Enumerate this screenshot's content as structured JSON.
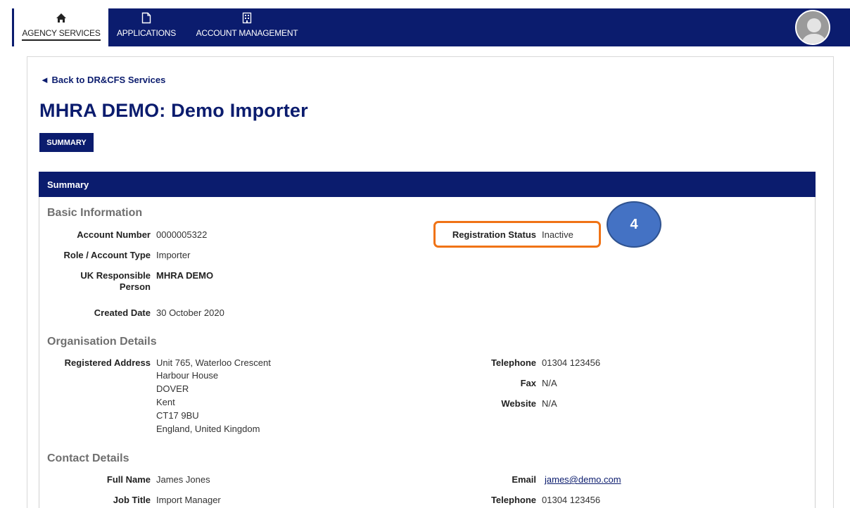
{
  "nav": {
    "items": [
      {
        "label": "AGENCY SERVICES",
        "icon": "home-icon"
      },
      {
        "label": "APPLICATIONS",
        "icon": "document-icon"
      },
      {
        "label": "ACCOUNT MANAGEMENT",
        "icon": "building-icon"
      }
    ],
    "accent": "#0b1c6e"
  },
  "back_link": "◄ Back to DR&CFS Services",
  "page_title": "MHRA DEMO: Demo Importer",
  "tabs": {
    "summary": "SUMMARY"
  },
  "panel_header": "Summary",
  "basic": {
    "title": "Basic Information",
    "account_number_label": "Account Number",
    "account_number": "0000005322",
    "role_label": "Role / Account Type",
    "role": "Importer",
    "ukrp_label_1": "UK Responsible",
    "ukrp_label_2": "Person",
    "ukrp": "MHRA DEMO",
    "created_label": "Created Date",
    "created": "30 October 2020",
    "reg_status_label": "Registration Status",
    "reg_status": "Inactive"
  },
  "org": {
    "title": "Organisation Details",
    "address_label": "Registered Address",
    "address": [
      "Unit 765, Waterloo Crescent",
      "Harbour House",
      "DOVER",
      "Kent",
      "CT17 9BU",
      "England, United Kingdom"
    ],
    "telephone_label": "Telephone",
    "telephone": "01304 123456",
    "fax_label": "Fax",
    "fax": "N/A",
    "website_label": "Website",
    "website": "N/A"
  },
  "contact": {
    "title": "Contact Details",
    "full_name_label": "Full Name",
    "full_name": "James Jones",
    "job_title_label": "Job Title",
    "job_title": "Import Manager",
    "email_label": "Email",
    "email": "james@demo.com",
    "telephone_label": "Telephone",
    "telephone": "01304 123456"
  },
  "callout": "4",
  "highlight_color": "#f07316"
}
